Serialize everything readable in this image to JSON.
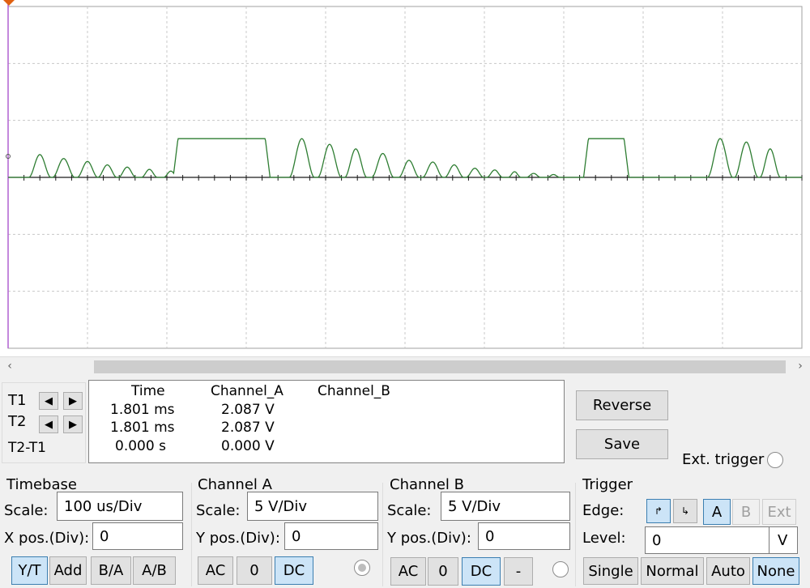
{
  "scope": {
    "grid_columns": 10,
    "grid_rows": 6,
    "grid_color": "#c8c8c8",
    "trace_color": "#2e7d32",
    "axis_color": "#1a1a1a",
    "trace": {
      "bumps": [
        {
          "t": 0.4,
          "w": 0.14,
          "h": 0.4
        },
        {
          "t": 0.7,
          "w": 0.14,
          "h": 0.33
        },
        {
          "t": 1.0,
          "w": 0.13,
          "h": 0.28
        },
        {
          "t": 1.25,
          "w": 0.12,
          "h": 0.22
        },
        {
          "t": 1.5,
          "w": 0.11,
          "h": 0.18
        },
        {
          "t": 1.78,
          "w": 0.1,
          "h": 0.14
        },
        {
          "t": 2.05,
          "w": 0.09,
          "h": 0.11
        },
        {
          "t": 3.7,
          "w": 0.16,
          "h": 0.68
        },
        {
          "t": 4.05,
          "w": 0.15,
          "h": 0.58
        },
        {
          "t": 4.38,
          "w": 0.14,
          "h": 0.5
        },
        {
          "t": 4.72,
          "w": 0.14,
          "h": 0.42
        },
        {
          "t": 5.05,
          "w": 0.13,
          "h": 0.3
        },
        {
          "t": 5.35,
          "w": 0.13,
          "h": 0.27
        },
        {
          "t": 5.62,
          "w": 0.12,
          "h": 0.22
        },
        {
          "t": 5.88,
          "w": 0.11,
          "h": 0.16
        },
        {
          "t": 6.13,
          "w": 0.1,
          "h": 0.13
        },
        {
          "t": 6.38,
          "w": 0.08,
          "h": 0.1
        },
        {
          "t": 6.62,
          "w": 0.09,
          "h": 0.07
        },
        {
          "t": 6.87,
          "w": 0.08,
          "h": 0.05
        },
        {
          "t": 8.97,
          "w": 0.16,
          "h": 0.68
        },
        {
          "t": 9.3,
          "w": 0.15,
          "h": 0.62
        },
        {
          "t": 9.6,
          "w": 0.13,
          "h": 0.5
        }
      ],
      "plateaus": [
        {
          "t0": 2.08,
          "t1": 3.3,
          "h": 0.68
        },
        {
          "t0": 7.25,
          "t1": 7.82,
          "h": 0.68
        }
      ]
    }
  },
  "cursors": {
    "t1_label": "T1",
    "t2_label": "T2",
    "t2t1_label": "T2-T1",
    "headers": {
      "time": "Time",
      "channel_a": "Channel_A",
      "channel_b": "Channel_B"
    },
    "rows": [
      {
        "time": "1.801 ms",
        "a": "2.087 V",
        "b": ""
      },
      {
        "time": "1.801 ms",
        "a": "2.087 V",
        "b": ""
      },
      {
        "time": "0.000 s",
        "a": "0.000 V",
        "b": ""
      }
    ]
  },
  "buttons": {
    "reverse": "Reverse",
    "save": "Save",
    "ext_trigger": "Ext. trigger"
  },
  "timebase": {
    "title": "Timebase",
    "scale_label": "Scale:",
    "scale_value": "100 us/Div",
    "xpos_label": "X pos.(Div):",
    "xpos_value": "0",
    "modes": [
      "Y/T",
      "Add",
      "B/A",
      "A/B"
    ]
  },
  "channel_a": {
    "title": "Channel A",
    "scale_label": "Scale:",
    "scale_value": "5  V/Div",
    "ypos_label": "Y pos.(Div):",
    "ypos_value": "0",
    "coupling": [
      "AC",
      "0",
      "DC"
    ]
  },
  "channel_b": {
    "title": "Channel B",
    "scale_label": "Scale:",
    "scale_value": "5  V/Div",
    "ypos_label": "Y pos.(Div):",
    "ypos_value": "0",
    "coupling": [
      "AC",
      "0",
      "DC",
      "-"
    ]
  },
  "trigger": {
    "title": "Trigger",
    "edge_label": "Edge:",
    "sources": [
      "A",
      "B",
      "Ext"
    ],
    "level_label": "Level:",
    "level_value": "0",
    "level_unit": "V",
    "modes": [
      "Single",
      "Normal",
      "Auto",
      "None"
    ]
  }
}
